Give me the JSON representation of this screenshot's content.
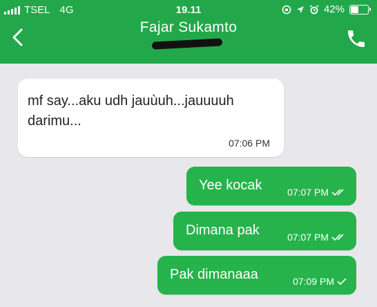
{
  "status_bar": {
    "carrier": "TSEL",
    "network": "4G",
    "time": "19.11",
    "battery": "42%",
    "battery_level": 0.42
  },
  "header": {
    "contact_name": "Fajar Sukamto",
    "colors": {
      "bar": "#22a84a",
      "outgoing_bubble": "#26b34b"
    },
    "back_icon": "chevron-left-icon",
    "call_icon": "phone-icon"
  },
  "messages": [
    {
      "direction": "incoming",
      "text": "mf say...aku udh jauùuh...jauuuuh darimu...",
      "time": "07:06 PM"
    },
    {
      "direction": "outgoing",
      "text": "Yee kocak",
      "time": "07:07 PM",
      "status": "double-check"
    },
    {
      "direction": "outgoing",
      "text": "Dimana pak",
      "time": "07:07 PM",
      "status": "double-check"
    },
    {
      "direction": "outgoing",
      "text": "Pak dimanaaa",
      "time": "07:09 PM",
      "status": "single-check"
    }
  ]
}
